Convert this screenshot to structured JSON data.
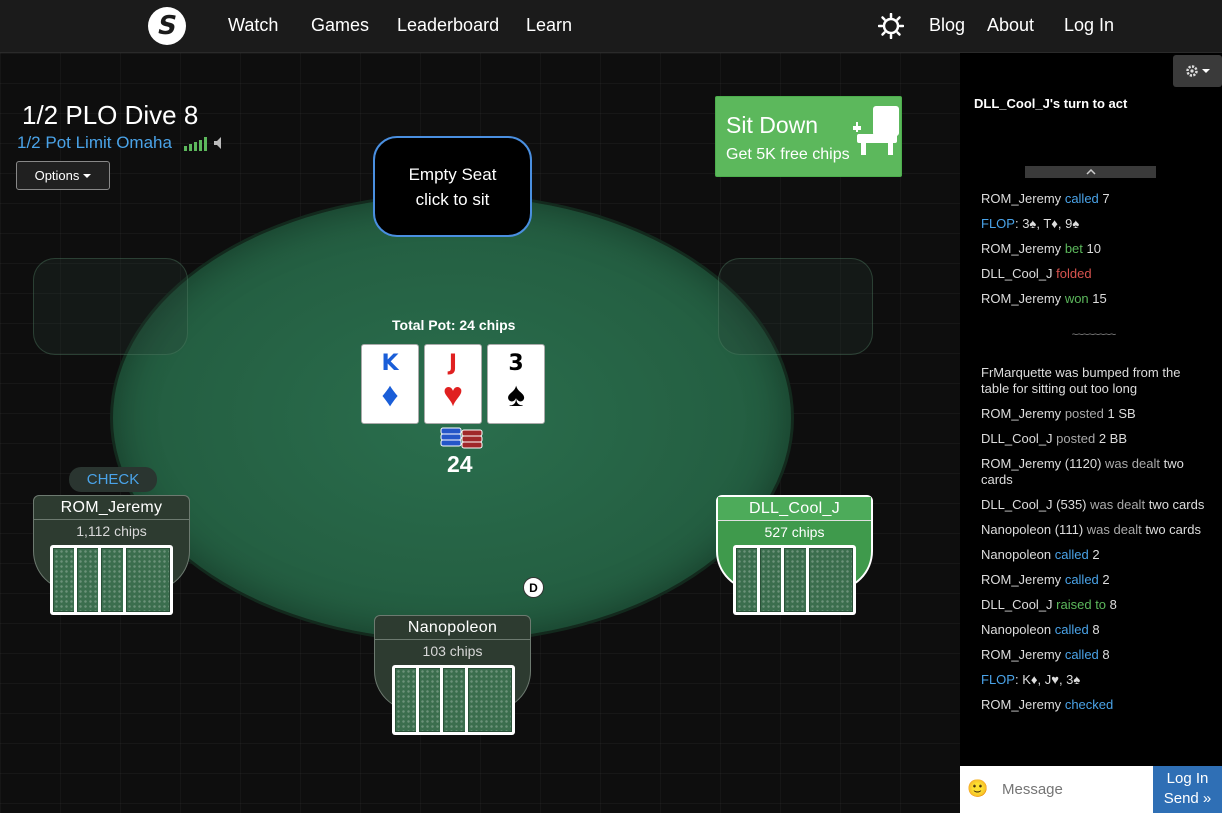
{
  "nav": {
    "logo_letter": "S",
    "links": [
      "Watch",
      "Games",
      "Leaderboard",
      "Learn"
    ],
    "right_links": [
      "Blog",
      "About",
      "Log In"
    ]
  },
  "table": {
    "title": "1/2 PLO Dive 8",
    "subtitle": "1/2 Pot Limit Omaha",
    "options_label": "Options",
    "sit_down": {
      "title": "Sit Down",
      "subtitle": "Get 5K free chips"
    },
    "empty_seat": {
      "line1": "Empty Seat",
      "line2": "click to sit"
    },
    "pot_label": "Total Pot: 24 chips",
    "pot_amount": "24",
    "board": [
      {
        "rank": "K",
        "suit": "♦",
        "color": "blue"
      },
      {
        "rank": "J",
        "suit": "♥",
        "color": "red"
      },
      {
        "rank": "3",
        "suit": "♠",
        "color": "black"
      }
    ],
    "check_label": "CHECK",
    "dealer_button": "D",
    "seats": [
      {
        "name": "ROM_Jeremy",
        "chips": "1,112 chips",
        "active": false
      },
      {
        "name": "DLL_Cool_J",
        "chips": "527 chips",
        "active": true
      },
      {
        "name": "Nanopoleon",
        "chips": "103 chips",
        "active": false
      }
    ]
  },
  "side": {
    "turn_msg": "DLL_Cool_J's turn to act",
    "separator": "~~~~~~~~",
    "log_top": [
      {
        "who": "ROM_Jeremy",
        "action": "called",
        "amount": "7",
        "kind": "called"
      },
      {
        "who": "FLOP",
        "action": "",
        "amount": ": 3♠, T♦, 9♠",
        "kind": "flop"
      },
      {
        "who": "ROM_Jeremy",
        "action": "bet",
        "amount": "10",
        "kind": "bet"
      },
      {
        "who": "DLL_Cool_J",
        "action": "folded",
        "amount": "",
        "kind": "fold"
      },
      {
        "who": "ROM_Jeremy",
        "action": "won",
        "amount": "15",
        "kind": "won"
      }
    ],
    "log_bottom": [
      {
        "text": "FrMarquette was bumped from the table for sitting out too long"
      },
      {
        "who": "ROM_Jeremy",
        "action": "posted",
        "amount": "1 SB",
        "kind": "grey"
      },
      {
        "who": "DLL_Cool_J",
        "action": "posted",
        "amount": "2 BB",
        "kind": "grey"
      },
      {
        "who": "ROM_Jeremy (1120)",
        "action": "was dealt",
        "amount": "two cards",
        "kind": "grey"
      },
      {
        "who": "DLL_Cool_J (535)",
        "action": "was dealt",
        "amount": "two cards",
        "kind": "grey"
      },
      {
        "who": "Nanopoleon (111)",
        "action": "was dealt",
        "amount": "two cards",
        "kind": "grey"
      },
      {
        "who": "Nanopoleon",
        "action": "called",
        "amount": "2",
        "kind": "called"
      },
      {
        "who": "ROM_Jeremy",
        "action": "called",
        "amount": "2",
        "kind": "called"
      },
      {
        "who": "DLL_Cool_J",
        "action": "raised to",
        "amount": "8",
        "kind": "raise"
      },
      {
        "who": "Nanopoleon",
        "action": "called",
        "amount": "8",
        "kind": "called"
      },
      {
        "who": "ROM_Jeremy",
        "action": "called",
        "amount": "8",
        "kind": "called"
      },
      {
        "who": "FLOP",
        "action": "",
        "amount": ": K♦, J♥, 3♠",
        "kind": "flop"
      },
      {
        "who": "ROM_Jeremy",
        "action": "checked",
        "amount": "",
        "kind": "called"
      }
    ],
    "chat_placeholder": "Message",
    "chat_btn_line1": "Log In",
    "chat_btn_line2": "Send »"
  }
}
